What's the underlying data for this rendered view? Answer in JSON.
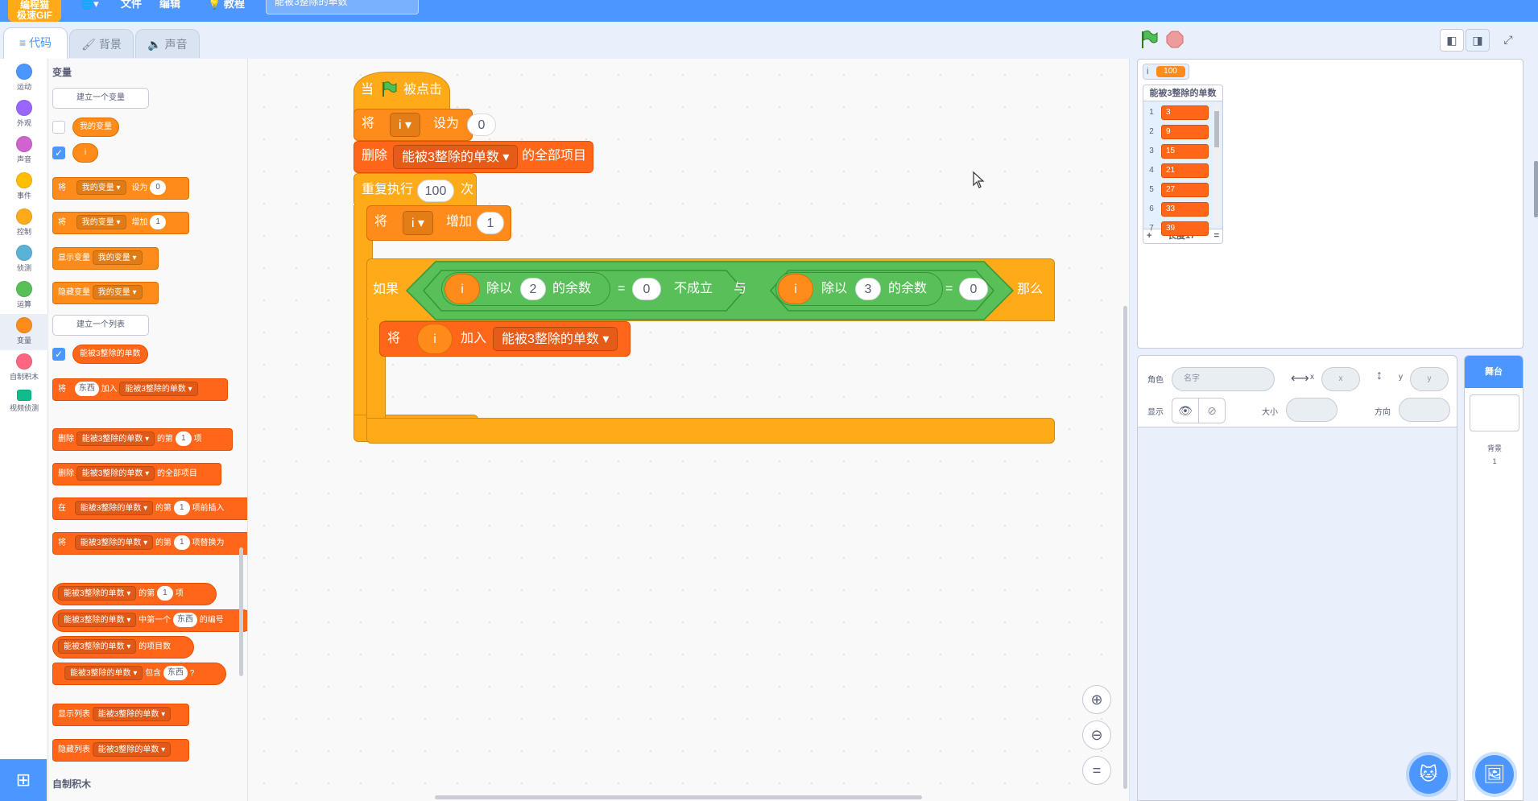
{
  "menubar": {
    "logo_text": "编程猫\n极速GIF",
    "globe_label": "🌐▾",
    "file_label": "文件",
    "edit_label": "编辑",
    "tutorial_label": "教程",
    "project_title": "能被3整除的单数"
  },
  "tabs": {
    "code": "代码",
    "backdrops": "背景",
    "sounds": "声音"
  },
  "categories": [
    {
      "label": "运动",
      "color": "#4c97ff"
    },
    {
      "label": "外观",
      "color": "#9966ff"
    },
    {
      "label": "声音",
      "color": "#cf63cf"
    },
    {
      "label": "事件",
      "color": "#ffbf00"
    },
    {
      "label": "控制",
      "color": "#ffab19"
    },
    {
      "label": "侦测",
      "color": "#5cb1d6"
    },
    {
      "label": "运算",
      "color": "#59c059"
    },
    {
      "label": "变量",
      "color": "#ff8c1a"
    },
    {
      "label": "自制积木",
      "color": "#ff6680"
    },
    {
      "label": "视频侦测",
      "color": "#0fbd8c"
    }
  ],
  "palette": {
    "heading_variables": "变量",
    "make_variable": "建立一个变量",
    "var_my": "我的变量",
    "var_i": "i",
    "set_label": "将",
    "set_to": "设为",
    "set_value": "0",
    "change_by": "增加",
    "change_value": "1",
    "show_var": "显示变量",
    "hide_var": "隐藏变量",
    "make_list": "建立一个列表",
    "list_name": "能被3整除的单数",
    "add": "加入",
    "thing": "东西",
    "delete": "删除",
    "of_item": "的第",
    "item": "项",
    "delete_all": "的全部项目",
    "insert_at": "在",
    "insert_suffix": "项前插入",
    "replace_suffix": "项替换为",
    "first_index": "中第一个",
    "index_suffix": "的编号",
    "length": "的项目数",
    "contains": "包含",
    "question": "?",
    "show_list": "显示列表",
    "hide_list": "隐藏列表",
    "heading_myblocks": "自制积木"
  },
  "script": {
    "hat_when": "当",
    "hat_clicked": "被点击",
    "set_label": "将",
    "set_var": "i",
    "set_to": "设为",
    "set_value": "0",
    "delete_label": "删除",
    "list_name": "能被3整除的单数",
    "delete_all": "的全部项目",
    "repeat_label": "重复执行",
    "repeat_times": "100",
    "repeat_suffix": "次",
    "change_label": "将",
    "change_var": "i",
    "change_by": "增加",
    "change_value": "1",
    "if_label": "如果",
    "mod_div": "除以",
    "mod_suffix": "的余数",
    "eq": "=",
    "divisor1": "2",
    "zero1": "0",
    "not_true": "不成立",
    "and_label": "与",
    "divisor2": "3",
    "zero2": "0",
    "then_label": "那么",
    "add_label": "将",
    "add_word": "加入",
    "var_i": "i"
  },
  "stage": {
    "var_name": "i",
    "var_value": "100",
    "list_title": "能被3整除的单数",
    "list_items": [
      {
        "index": "1",
        "value": "3"
      },
      {
        "index": "2",
        "value": "9"
      },
      {
        "index": "3",
        "value": "15"
      },
      {
        "index": "4",
        "value": "21"
      },
      {
        "index": "5",
        "value": "27"
      },
      {
        "index": "6",
        "value": "33"
      },
      {
        "index": "7",
        "value": "39"
      }
    ],
    "list_add": "+",
    "list_length": "长度17",
    "list_resize": "="
  },
  "sprite_info": {
    "sprite_label": "角色",
    "name_placeholder": "名字",
    "x_label": "x",
    "x_placeholder": "x",
    "y_label": "y",
    "y_placeholder": "y",
    "show_label": "显示",
    "size_label": "大小",
    "direction_label": "方向"
  },
  "stage_pane": {
    "title": "舞台",
    "backdrops_label": "背景",
    "backdrops_count": "1"
  },
  "colors": {
    "accent": "#4c97ff",
    "control": "#ffab19",
    "variables": "#ff8c1a",
    "lists": "#ff661a",
    "operators": "#59c059"
  }
}
